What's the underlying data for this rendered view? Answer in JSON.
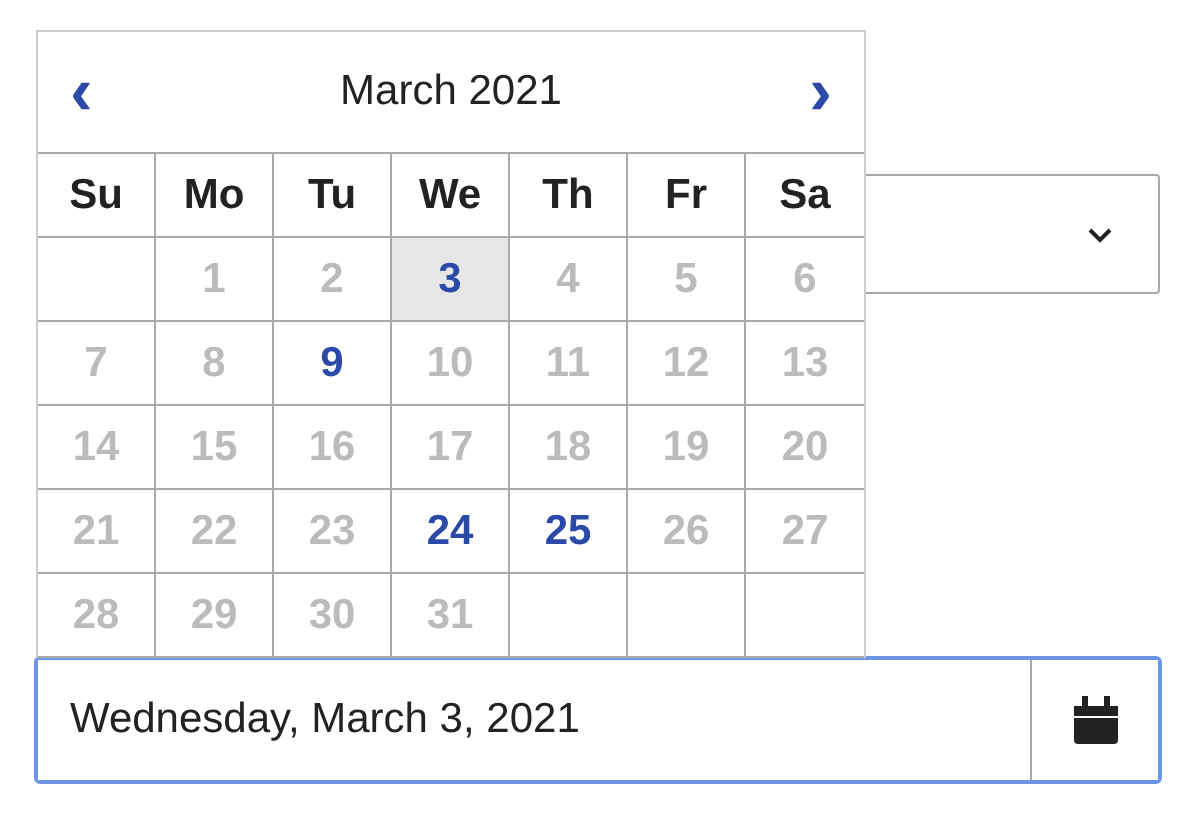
{
  "calendar": {
    "month": "March 2021",
    "prev": "‹",
    "next": "›",
    "weekdays": [
      "Su",
      "Mo",
      "Tu",
      "We",
      "Th",
      "Fr",
      "Sa"
    ],
    "days": [
      {
        "kind": "empty"
      },
      {
        "kind": "day",
        "label": "1",
        "available": false,
        "selected": false
      },
      {
        "kind": "day",
        "label": "2",
        "available": false,
        "selected": false
      },
      {
        "kind": "day",
        "label": "3",
        "available": true,
        "selected": true
      },
      {
        "kind": "day",
        "label": "4",
        "available": false,
        "selected": false
      },
      {
        "kind": "day",
        "label": "5",
        "available": false,
        "selected": false
      },
      {
        "kind": "day",
        "label": "6",
        "available": false,
        "selected": false
      },
      {
        "kind": "day",
        "label": "7",
        "available": false,
        "selected": false
      },
      {
        "kind": "day",
        "label": "8",
        "available": false,
        "selected": false
      },
      {
        "kind": "day",
        "label": "9",
        "available": true,
        "selected": false
      },
      {
        "kind": "day",
        "label": "10",
        "available": false,
        "selected": false
      },
      {
        "kind": "day",
        "label": "11",
        "available": false,
        "selected": false
      },
      {
        "kind": "day",
        "label": "12",
        "available": false,
        "selected": false
      },
      {
        "kind": "day",
        "label": "13",
        "available": false,
        "selected": false
      },
      {
        "kind": "day",
        "label": "14",
        "available": false,
        "selected": false
      },
      {
        "kind": "day",
        "label": "15",
        "available": false,
        "selected": false
      },
      {
        "kind": "day",
        "label": "16",
        "available": false,
        "selected": false
      },
      {
        "kind": "day",
        "label": "17",
        "available": false,
        "selected": false
      },
      {
        "kind": "day",
        "label": "18",
        "available": false,
        "selected": false
      },
      {
        "kind": "day",
        "label": "19",
        "available": false,
        "selected": false
      },
      {
        "kind": "day",
        "label": "20",
        "available": false,
        "selected": false
      },
      {
        "kind": "day",
        "label": "21",
        "available": false,
        "selected": false
      },
      {
        "kind": "day",
        "label": "22",
        "available": false,
        "selected": false
      },
      {
        "kind": "day",
        "label": "23",
        "available": false,
        "selected": false
      },
      {
        "kind": "day",
        "label": "24",
        "available": true,
        "selected": false
      },
      {
        "kind": "day",
        "label": "25",
        "available": true,
        "selected": false
      },
      {
        "kind": "day",
        "label": "26",
        "available": false,
        "selected": false
      },
      {
        "kind": "day",
        "label": "27",
        "available": false,
        "selected": false
      },
      {
        "kind": "day",
        "label": "28",
        "available": false,
        "selected": false
      },
      {
        "kind": "day",
        "label": "29",
        "available": false,
        "selected": false
      },
      {
        "kind": "day",
        "label": "30",
        "available": false,
        "selected": false
      },
      {
        "kind": "day",
        "label": "31",
        "available": false,
        "selected": false
      },
      {
        "kind": "empty"
      },
      {
        "kind": "empty"
      },
      {
        "kind": "empty"
      }
    ]
  },
  "date_field": {
    "value": "Wednesday, March 3, 2021"
  }
}
